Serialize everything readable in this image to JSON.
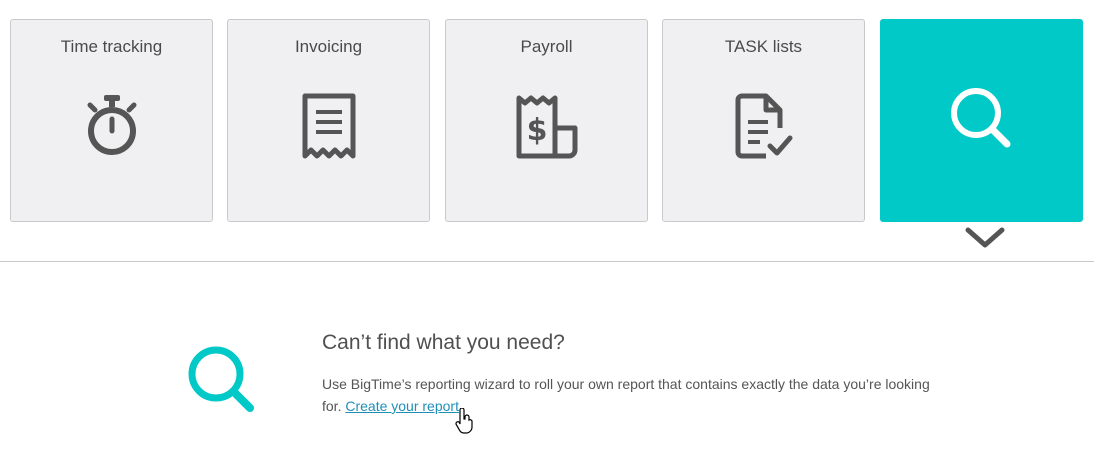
{
  "tiles": [
    {
      "label": "Time tracking",
      "icon": "stopwatch-icon"
    },
    {
      "label": "Invoicing",
      "icon": "receipt-icon"
    },
    {
      "label": "Payroll",
      "icon": "payroll-icon"
    },
    {
      "label": "TASK lists",
      "icon": "task-list-icon"
    },
    {
      "label": "",
      "icon": "search-icon",
      "active": true
    }
  ],
  "cta": {
    "title": "Can’t find what you need?",
    "text": "Use BigTime’s reporting wizard to roll your own report that contains exactly the data you’re looking for. ",
    "link": "Create your report"
  },
  "colors": {
    "accent": "#00c9c8",
    "tile_bg": "#f0f0f2",
    "icon": "#555555",
    "link": "#1f8fb8"
  }
}
